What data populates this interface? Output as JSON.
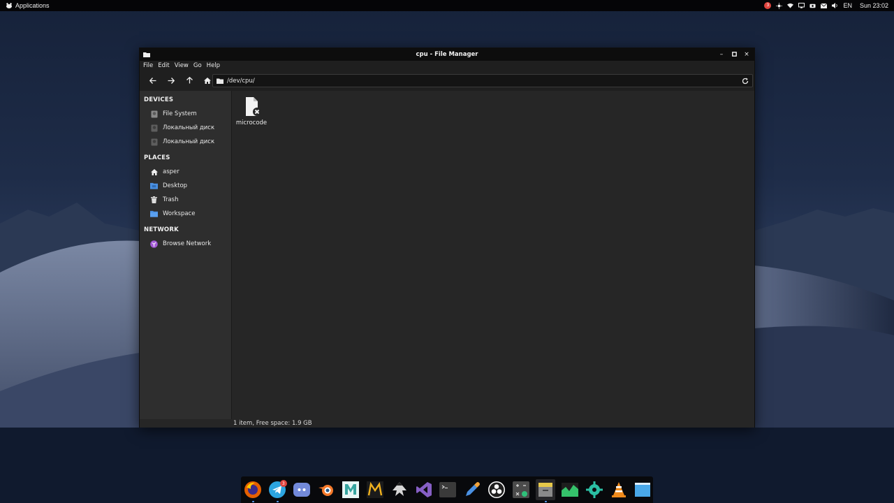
{
  "top_panel": {
    "apps_label": "Applications",
    "notification_count": "3",
    "language": "EN",
    "clock": "Sun 23:02",
    "icons": [
      "bug-icon",
      "brightness-icon",
      "wifi-icon",
      "screen-icon",
      "vpn-icon",
      "mail-icon",
      "volume-icon"
    ]
  },
  "window": {
    "title": "cpu - File Manager",
    "controls": {
      "minimize": "–",
      "maximize": "□",
      "close": "×"
    }
  },
  "menu": [
    "File",
    "Edit",
    "View",
    "Go",
    "Help"
  ],
  "toolbar": {
    "buttons": [
      "back-icon",
      "forward-icon",
      "up-icon",
      "home-icon"
    ],
    "location": "/dev/cpu/"
  },
  "sidebar": {
    "devices_heading": "DEVICES",
    "devices": [
      {
        "label": "File System",
        "icon": "drive-icon"
      },
      {
        "label": "Локальный диск",
        "icon": "drive-icon"
      },
      {
        "label": "Локальный диск",
        "icon": "drive-icon"
      }
    ],
    "places_heading": "PLACES",
    "places": [
      {
        "label": "asper",
        "icon": "home-icon"
      },
      {
        "label": "Desktop",
        "icon": "desktop-folder-icon"
      },
      {
        "label": "Trash",
        "icon": "trash-icon"
      },
      {
        "label": "Workspace",
        "icon": "folder-icon"
      }
    ],
    "network_heading": "NETWORK",
    "network": [
      {
        "label": "Browse Network",
        "icon": "network-icon"
      }
    ]
  },
  "files": [
    {
      "name": "microcode",
      "icon": "broken-file-icon"
    }
  ],
  "status": "1 item, Free space: 1.9 GB",
  "dock": {
    "apps": [
      {
        "name": "firefox",
        "running": true
      },
      {
        "name": "telegram",
        "badge": "3",
        "running": true
      },
      {
        "name": "discord"
      },
      {
        "name": "blender"
      },
      {
        "name": "maya"
      },
      {
        "name": "mudbox"
      },
      {
        "name": "inkscape"
      },
      {
        "name": "visual-studio"
      },
      {
        "name": "terminal"
      },
      {
        "name": "color-picker"
      },
      {
        "name": "obs"
      },
      {
        "name": "calculator"
      },
      {
        "name": "file-manager",
        "running": true,
        "active": true
      },
      {
        "name": "system-monitor"
      },
      {
        "name": "settings"
      },
      {
        "name": "vlc"
      },
      {
        "name": "desktop"
      }
    ]
  },
  "colors": {
    "window_bg": "#262626",
    "sidebar_bg": "#2e2e2e",
    "titlebar_bg": "#0d0d0d",
    "accent_blue": "#4a90e2"
  }
}
